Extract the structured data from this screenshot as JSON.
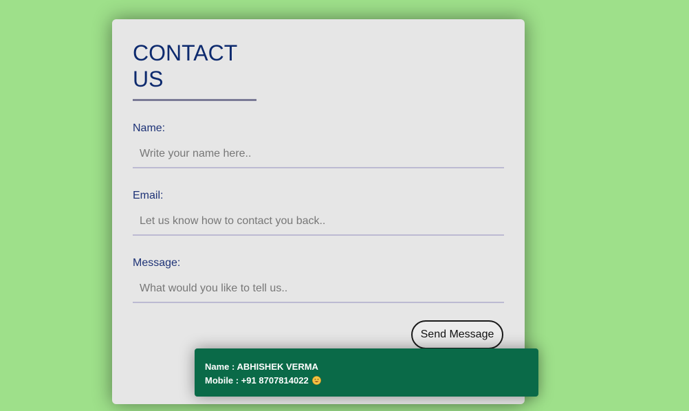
{
  "form": {
    "title": "CONTACT US",
    "name_label": "Name:",
    "name_placeholder": "Write your name here..",
    "email_label": "Email:",
    "email_placeholder": "Let us know how to contact you back..",
    "message_label": "Message:",
    "message_placeholder": "What would you like to tell us..",
    "submit_label": "Send Message"
  },
  "toast": {
    "name_line": "Name : ABHISHEK VERMA",
    "mobile_line": "Mobile : +91 8707814022",
    "emoji_icon": "smiling-face-icon"
  },
  "colors": {
    "page_background": "#9ee08a",
    "card_background": "#e6e6e6",
    "title_text": "#0d2a6e",
    "toast_background": "#0a6a48"
  }
}
